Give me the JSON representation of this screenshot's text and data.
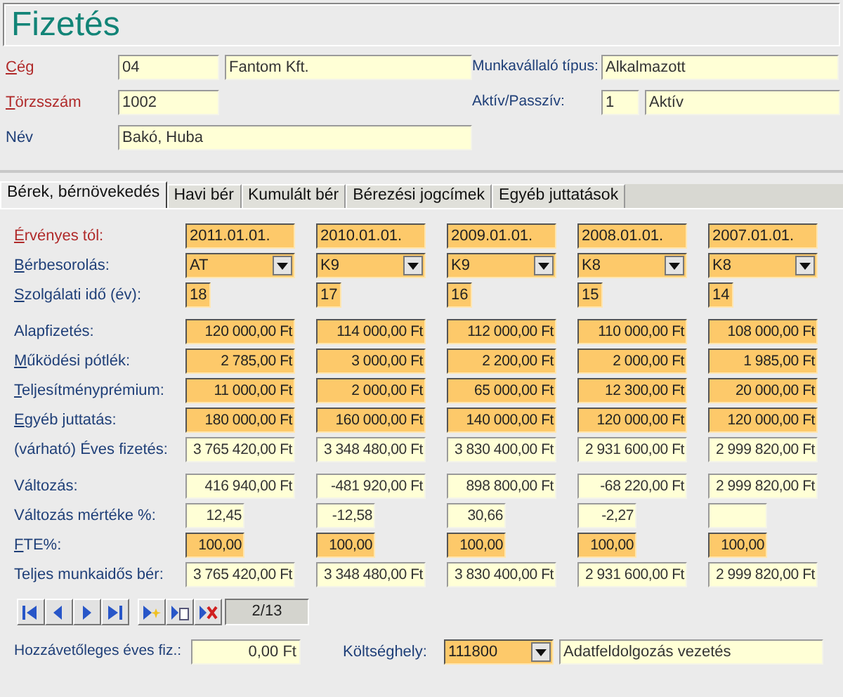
{
  "title": "Fizetés",
  "header": [
    {
      "label": "Cég",
      "required": true,
      "access_key": true,
      "fields": [
        {
          "kind": "short",
          "value": "04"
        },
        {
          "kind": "long",
          "value": "Fantom Kft."
        }
      ]
    },
    {
      "label": "Törzsszám",
      "required": true,
      "access_key": true,
      "fields": [
        {
          "kind": "short",
          "value": "1002"
        }
      ]
    },
    {
      "label": "Név",
      "required": false,
      "access_key": false,
      "fields": [
        {
          "kind": "full",
          "value": "Bakó, Huba"
        }
      ]
    }
  ],
  "header_right": [
    {
      "label": "Munkavállaló típus:",
      "fields": [
        {
          "kind": "wide",
          "value": "Alkalmazott"
        }
      ]
    },
    {
      "label": "Aktív/Passzív:",
      "fields": [
        {
          "kind": "tiny",
          "value": "1"
        },
        {
          "kind": "rest",
          "value": "Aktív"
        }
      ]
    }
  ],
  "tabs": [
    {
      "label": "Bérek, bérnövekedés",
      "selected": true
    },
    {
      "label": "Havi bér",
      "selected": false
    },
    {
      "label": "Kumulált bér",
      "selected": false
    },
    {
      "label": "Bérezési jogcímek",
      "selected": false
    },
    {
      "label": "Egyéb juttatások",
      "selected": false
    }
  ],
  "sections": [
    {
      "rows": [
        {
          "label": "Érvényes tól:",
          "required": true,
          "access_key": true,
          "kind": "date",
          "editable": true,
          "cells": [
            {
              "value": "2011.01.01."
            },
            {
              "value": "2010.01.01."
            },
            {
              "value": "2009.01.01."
            },
            {
              "value": "2008.01.01."
            },
            {
              "value": "2007.01.01."
            }
          ]
        },
        {
          "label": "Bérbesorolás:",
          "required": false,
          "access_key": true,
          "kind": "combo",
          "editable": true,
          "cells": [
            {
              "value": "AT"
            },
            {
              "value": "K9"
            },
            {
              "value": "K9"
            },
            {
              "value": "K8"
            },
            {
              "value": "K8"
            }
          ]
        },
        {
          "label": "Szolgálati idő (év):",
          "required": false,
          "access_key": true,
          "kind": "year",
          "editable": true,
          "cells": [
            {
              "value": "18"
            },
            {
              "value": "17"
            },
            {
              "value": "16"
            },
            {
              "value": "15"
            },
            {
              "value": "14"
            }
          ]
        }
      ]
    },
    {
      "rows": [
        {
          "label": "Alapfizetés:",
          "required": false,
          "access_key": false,
          "kind": "money",
          "editable": true,
          "cells": [
            {
              "value": "120 000,00 Ft"
            },
            {
              "value": "114 000,00 Ft"
            },
            {
              "value": "112 000,00 Ft"
            },
            {
              "value": "110 000,00 Ft"
            },
            {
              "value": "108 000,00 Ft"
            }
          ]
        },
        {
          "label": "Működési pótlék:",
          "required": false,
          "access_key": true,
          "kind": "money",
          "editable": true,
          "cells": [
            {
              "value": "2 785,00 Ft"
            },
            {
              "value": "3 000,00 Ft"
            },
            {
              "value": "2 200,00 Ft"
            },
            {
              "value": "2 000,00 Ft"
            },
            {
              "value": "1 985,00 Ft"
            }
          ]
        },
        {
          "label": "Teljesítményprémium:",
          "required": false,
          "access_key": true,
          "kind": "money",
          "editable": true,
          "cells": [
            {
              "value": "11 000,00 Ft"
            },
            {
              "value": "2 000,00 Ft"
            },
            {
              "value": "65 000,00 Ft"
            },
            {
              "value": "12 300,00 Ft"
            },
            {
              "value": "20 000,00 Ft"
            }
          ]
        },
        {
          "label": "Egyéb juttatás:",
          "required": false,
          "access_key": true,
          "kind": "money",
          "editable": true,
          "cells": [
            {
              "value": "180 000,00 Ft"
            },
            {
              "value": "160 000,00 Ft"
            },
            {
              "value": "140 000,00 Ft"
            },
            {
              "value": "120 000,00 Ft"
            },
            {
              "value": "120 000,00 Ft"
            }
          ]
        },
        {
          "label": "(várható) Éves fizetés:",
          "required": false,
          "access_key": false,
          "kind": "money",
          "editable": false,
          "cells": [
            {
              "value": "3 765 420,00 Ft"
            },
            {
              "value": "3 348 480,00 Ft"
            },
            {
              "value": "3 830 400,00 Ft"
            },
            {
              "value": "2 931 600,00 Ft"
            },
            {
              "value": "2 999 820,00 Ft"
            }
          ]
        }
      ]
    },
    {
      "rows": [
        {
          "label": "Változás:",
          "required": false,
          "access_key": false,
          "kind": "money",
          "editable": false,
          "cells": [
            {
              "value": "416 940,00 Ft"
            },
            {
              "value": "-481 920,00 Ft"
            },
            {
              "value": "898 800,00 Ft"
            },
            {
              "value": "-68 220,00 Ft"
            },
            {
              "value": "2 999 820,00 Ft"
            }
          ]
        },
        {
          "label": "Változás mértéke %:",
          "required": false,
          "access_key": false,
          "kind": "percent",
          "editable": false,
          "cells": [
            {
              "value": "12,45"
            },
            {
              "value": "-12,58"
            },
            {
              "value": "30,66"
            },
            {
              "value": "-2,27"
            },
            {}
          ]
        },
        {
          "label": "FTE%:",
          "required": false,
          "access_key": true,
          "kind": "percent",
          "editable": true,
          "cells": [
            {
              "value": "100,00"
            },
            {
              "value": "100,00"
            },
            {
              "value": "100,00"
            },
            {
              "value": "100,00"
            },
            {
              "value": "100,00"
            }
          ]
        },
        {
          "label": "Teljes munkaidős bér:",
          "required": false,
          "access_key": false,
          "kind": "money",
          "editable": false,
          "cells": [
            {
              "value": "3 765 420,00 Ft"
            },
            {
              "value": "3 348 480,00 Ft"
            },
            {
              "value": "3 830 400,00 Ft"
            },
            {
              "value": "2 931 600,00 Ft"
            },
            {
              "value": "2 999 820,00 Ft"
            }
          ]
        }
      ]
    }
  ],
  "record_counter": "2/13",
  "footer": {
    "estimate_label": "Hozzávetőleges éves fiz.:",
    "estimate_value": "0,00 Ft",
    "cost_center_label": "Költséghely:",
    "cost_center_code": "111800",
    "cost_center_name": "Adatfeldolgozás vezetés"
  }
}
